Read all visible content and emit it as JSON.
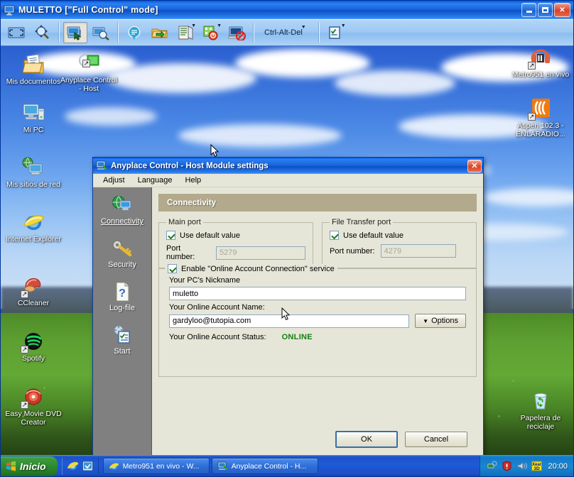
{
  "app_window": {
    "title": "MULETTO [\"Full Control\" mode]",
    "icon": "monitor-icon",
    "window_buttons": {
      "minimize_label": "_",
      "maximize_label": "□",
      "close_label": "✕"
    },
    "toolbar": {
      "items": [
        {
          "name": "fullscreen-icon",
          "label": "",
          "type": "icon",
          "pressed": false
        },
        {
          "name": "zoom-icon",
          "label": "",
          "type": "icon",
          "pressed": false
        },
        {
          "name": "full-control-mode-icon",
          "label": "",
          "type": "icon",
          "pressed": true
        },
        {
          "name": "view-only-mode-icon",
          "label": "",
          "type": "icon",
          "pressed": false
        },
        {
          "name": "chat-icon",
          "label": "",
          "type": "icon",
          "pressed": false
        },
        {
          "name": "file-transfer-icon",
          "label": "",
          "type": "icon",
          "pressed": false
        },
        {
          "name": "clipboard-icon",
          "label": "",
          "type": "icon",
          "pressed": false,
          "has_dropdown": true
        },
        {
          "name": "power-options-icon",
          "label": "",
          "type": "icon",
          "pressed": false,
          "has_dropdown": true
        },
        {
          "name": "blank-monitor-icon",
          "label": "",
          "type": "icon",
          "pressed": false
        },
        {
          "name": "ctrl-alt-del-button",
          "label": "Ctrl-Alt-Del",
          "type": "text",
          "has_dropdown": true
        },
        {
          "name": "task-list-icon",
          "label": "",
          "type": "icon",
          "pressed": false,
          "has_dropdown": true
        }
      ]
    }
  },
  "desktop": {
    "icons_left": [
      {
        "name": "mis-documentos",
        "label": "Mis documentos",
        "icon": "documents-folder-icon",
        "shortcut": false
      },
      {
        "name": "anyplace-control-host",
        "label": "Anyplace Control - Host",
        "icon": "anyplace-host-icon",
        "shortcut": true
      },
      {
        "name": "mi-pc",
        "label": "Mi PC",
        "icon": "computer-icon",
        "shortcut": false
      },
      {
        "name": "mis-sitios-de-red",
        "label": "Mis sitios de red",
        "icon": "network-places-icon",
        "shortcut": false
      },
      {
        "name": "internet-explorer",
        "label": "Internet Explorer",
        "icon": "internet-explorer-icon",
        "shortcut": false
      },
      {
        "name": "ccleaner",
        "label": "CCleaner",
        "icon": "ccleaner-icon",
        "shortcut": true
      },
      {
        "name": "spotify",
        "label": "Spotify",
        "icon": "spotify-icon",
        "shortcut": true
      },
      {
        "name": "easy-movie-dvd-creator",
        "label": "Easy Movie DVD Creator",
        "icon": "dvd-creator-icon",
        "shortcut": true
      }
    ],
    "icons_right": [
      {
        "name": "metro951",
        "label": "Metro951 en vivo",
        "icon": "radio-icon",
        "shortcut": true
      },
      {
        "name": "aspen",
        "label": "Aspen 102.3 - ENLARADIO...",
        "icon": "radio-orange-icon",
        "shortcut": true
      },
      {
        "name": "papelera",
        "label": "Papelera de reciclaje",
        "icon": "recycle-bin-icon",
        "shortcut": false
      }
    ]
  },
  "dialog": {
    "title": "Anyplace Control - Host Module settings",
    "icon": "anyplace-settings-icon",
    "close_label": "✕",
    "menubar": [
      "Adjust",
      "Language",
      "Help"
    ],
    "sidebar": [
      {
        "name": "connectivity",
        "label": "Connectivity",
        "icon": "globe-network-icon",
        "active": true
      },
      {
        "name": "security",
        "label": "Security",
        "icon": "key-icon",
        "active": false
      },
      {
        "name": "log-file",
        "label": "Log-file",
        "icon": "question-document-icon",
        "active": false
      },
      {
        "name": "start",
        "label": "Start",
        "icon": "startup-checklist-icon",
        "active": false
      }
    ],
    "section_title": "Connectivity",
    "main_port": {
      "legend": "Main port",
      "use_default_label": "Use default value",
      "use_default_checked": true,
      "port_label": "Port number:",
      "port_value": "5279",
      "port_disabled": true
    },
    "file_transfer_port": {
      "legend": "File Transfer port",
      "use_default_label": "Use default value",
      "use_default_checked": true,
      "port_label": "Port number:",
      "port_value": "4279",
      "port_disabled": true
    },
    "online_account": {
      "enable_label": "Enable \"Online Account Connection\" service",
      "enable_checked": true,
      "nickname_label": "Your PC's Nickname",
      "nickname_value": "muletto",
      "account_label": "Your Online Account Name:",
      "account_value": "gardyloo@tutopia.com",
      "options_button": "Options",
      "status_label": "Your Online Account Status:",
      "status_value": "ONLINE",
      "status_color": "#138013"
    },
    "ok_label": "OK",
    "cancel_label": "Cancel"
  },
  "taskbar": {
    "start_label": "Inicio",
    "quick_launch": [
      {
        "name": "quicklaunch-internet-explorer",
        "icon": "internet-explorer-icon"
      },
      {
        "name": "quicklaunch-show-desktop",
        "icon": "show-desktop-icon"
      }
    ],
    "tasks": [
      {
        "name": "task-metro951",
        "label": "Metro951 en vivo - W...",
        "icon": "internet-explorer-icon",
        "active": false
      },
      {
        "name": "task-anyplace",
        "label": "Anyplace Control - H...",
        "icon": "anyplace-settings-icon",
        "active": true
      }
    ],
    "tray_icons": [
      {
        "name": "network-tray-icon"
      },
      {
        "name": "antivirus-shield-tray-icon"
      },
      {
        "name": "volume-tray-icon"
      },
      {
        "name": "xear3d-tray-icon"
      }
    ],
    "clock": "20:00"
  },
  "theme": {
    "titlebar_blue": "#0a4fc4",
    "toolbar_blue": "#9fc9f3",
    "dialog_bg": "#e6e6d8",
    "sidebar_gray": "#808080",
    "section_header": "#b3a98c",
    "online_green": "#138013",
    "start_green": "#2f8a2f",
    "taskbar_blue": "#1f5ad6"
  }
}
